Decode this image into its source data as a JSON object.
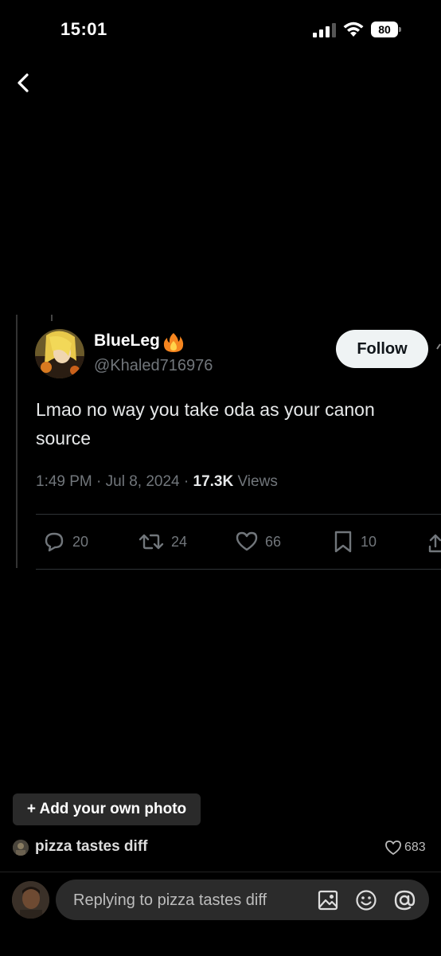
{
  "status": {
    "time": "15:01",
    "battery": "80"
  },
  "tweet": {
    "display_name": "BlueLeg",
    "handle": "@Khaled716976",
    "follow_label": "Follow",
    "text": "Lmao no way you take oda as your canon source",
    "timestamp": "1:49 PM · Jul 8, 2024 · ",
    "views_count": "17.3K",
    "views_label": " Views",
    "replies": "20",
    "retweets": "24",
    "likes": "66",
    "bookmarks": "10"
  },
  "bottom": {
    "add_photo_label": "+ Add your own photo",
    "commenter": "pizza tastes diff",
    "like_count": "683",
    "reply_placeholder": "Replying to pizza tastes diff"
  },
  "icons": {
    "back": "chevron-left-icon",
    "reply": "speech-bubble-icon",
    "retweet": "retweet-icon",
    "like": "heart-icon",
    "bookmark": "bookmark-icon",
    "share": "share-icon",
    "image": "image-icon",
    "emoji": "emoji-icon",
    "mention": "at-icon"
  },
  "colors": {
    "background": "#000000",
    "muted": "#71767b",
    "follow_bg": "#eff3f4"
  }
}
